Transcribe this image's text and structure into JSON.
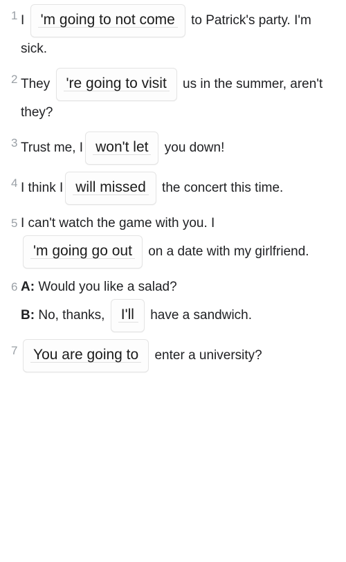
{
  "exercise": {
    "accent_color": "#9aa0a6",
    "text_color": "#202124",
    "box_border_color": "#e4e4e4",
    "box_rule_color": "#e0e0e0",
    "items": [
      {
        "number": "1",
        "before": "I ",
        "answer": "'m going to not come",
        "after": " to Patrick's party. I'm sick."
      },
      {
        "number": "2",
        "before": "They ",
        "answer": "'re going to visit",
        "after": " us in the summer, aren't they?"
      },
      {
        "number": "3",
        "before": "Trust me, I",
        "answer": "won't let",
        "after": " you down!"
      },
      {
        "number": "4",
        "before": "I think I",
        "answer": "will missed",
        "after": " the concert this time."
      },
      {
        "number": "5",
        "before": "I can't watch the game with you. I ",
        "answer": "'m going go out",
        "after": " on a date with my girlfriend."
      },
      {
        "number": "6",
        "speaker_a": "A:",
        "line_a": " Would you like a salad?",
        "speaker_b": "B:",
        "before": " No, thanks, ",
        "answer": "I'll",
        "after": " have a sandwich."
      },
      {
        "number": "7",
        "before": "",
        "answer": "You are going to",
        "after": " enter a university?"
      }
    ]
  }
}
